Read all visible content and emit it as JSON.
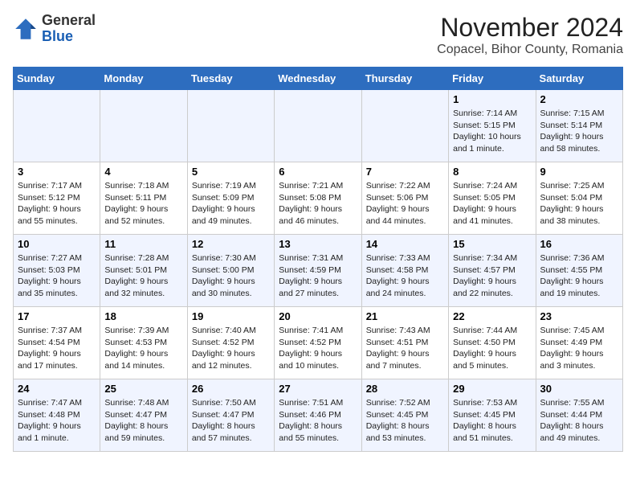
{
  "header": {
    "logo_line1": "General",
    "logo_line2": "Blue",
    "title": "November 2024",
    "subtitle": "Copacel, Bihor County, Romania"
  },
  "weekdays": [
    "Sunday",
    "Monday",
    "Tuesday",
    "Wednesday",
    "Thursday",
    "Friday",
    "Saturday"
  ],
  "weeks": [
    [
      {
        "day": "",
        "info": ""
      },
      {
        "day": "",
        "info": ""
      },
      {
        "day": "",
        "info": ""
      },
      {
        "day": "",
        "info": ""
      },
      {
        "day": "",
        "info": ""
      },
      {
        "day": "1",
        "info": "Sunrise: 7:14 AM\nSunset: 5:15 PM\nDaylight: 10 hours and 1 minute."
      },
      {
        "day": "2",
        "info": "Sunrise: 7:15 AM\nSunset: 5:14 PM\nDaylight: 9 hours and 58 minutes."
      }
    ],
    [
      {
        "day": "3",
        "info": "Sunrise: 7:17 AM\nSunset: 5:12 PM\nDaylight: 9 hours and 55 minutes."
      },
      {
        "day": "4",
        "info": "Sunrise: 7:18 AM\nSunset: 5:11 PM\nDaylight: 9 hours and 52 minutes."
      },
      {
        "day": "5",
        "info": "Sunrise: 7:19 AM\nSunset: 5:09 PM\nDaylight: 9 hours and 49 minutes."
      },
      {
        "day": "6",
        "info": "Sunrise: 7:21 AM\nSunset: 5:08 PM\nDaylight: 9 hours and 46 minutes."
      },
      {
        "day": "7",
        "info": "Sunrise: 7:22 AM\nSunset: 5:06 PM\nDaylight: 9 hours and 44 minutes."
      },
      {
        "day": "8",
        "info": "Sunrise: 7:24 AM\nSunset: 5:05 PM\nDaylight: 9 hours and 41 minutes."
      },
      {
        "day": "9",
        "info": "Sunrise: 7:25 AM\nSunset: 5:04 PM\nDaylight: 9 hours and 38 minutes."
      }
    ],
    [
      {
        "day": "10",
        "info": "Sunrise: 7:27 AM\nSunset: 5:03 PM\nDaylight: 9 hours and 35 minutes."
      },
      {
        "day": "11",
        "info": "Sunrise: 7:28 AM\nSunset: 5:01 PM\nDaylight: 9 hours and 32 minutes."
      },
      {
        "day": "12",
        "info": "Sunrise: 7:30 AM\nSunset: 5:00 PM\nDaylight: 9 hours and 30 minutes."
      },
      {
        "day": "13",
        "info": "Sunrise: 7:31 AM\nSunset: 4:59 PM\nDaylight: 9 hours and 27 minutes."
      },
      {
        "day": "14",
        "info": "Sunrise: 7:33 AM\nSunset: 4:58 PM\nDaylight: 9 hours and 24 minutes."
      },
      {
        "day": "15",
        "info": "Sunrise: 7:34 AM\nSunset: 4:57 PM\nDaylight: 9 hours and 22 minutes."
      },
      {
        "day": "16",
        "info": "Sunrise: 7:36 AM\nSunset: 4:55 PM\nDaylight: 9 hours and 19 minutes."
      }
    ],
    [
      {
        "day": "17",
        "info": "Sunrise: 7:37 AM\nSunset: 4:54 PM\nDaylight: 9 hours and 17 minutes."
      },
      {
        "day": "18",
        "info": "Sunrise: 7:39 AM\nSunset: 4:53 PM\nDaylight: 9 hours and 14 minutes."
      },
      {
        "day": "19",
        "info": "Sunrise: 7:40 AM\nSunset: 4:52 PM\nDaylight: 9 hours and 12 minutes."
      },
      {
        "day": "20",
        "info": "Sunrise: 7:41 AM\nSunset: 4:52 PM\nDaylight: 9 hours and 10 minutes."
      },
      {
        "day": "21",
        "info": "Sunrise: 7:43 AM\nSunset: 4:51 PM\nDaylight: 9 hours and 7 minutes."
      },
      {
        "day": "22",
        "info": "Sunrise: 7:44 AM\nSunset: 4:50 PM\nDaylight: 9 hours and 5 minutes."
      },
      {
        "day": "23",
        "info": "Sunrise: 7:45 AM\nSunset: 4:49 PM\nDaylight: 9 hours and 3 minutes."
      }
    ],
    [
      {
        "day": "24",
        "info": "Sunrise: 7:47 AM\nSunset: 4:48 PM\nDaylight: 9 hours and 1 minute."
      },
      {
        "day": "25",
        "info": "Sunrise: 7:48 AM\nSunset: 4:47 PM\nDaylight: 8 hours and 59 minutes."
      },
      {
        "day": "26",
        "info": "Sunrise: 7:50 AM\nSunset: 4:47 PM\nDaylight: 8 hours and 57 minutes."
      },
      {
        "day": "27",
        "info": "Sunrise: 7:51 AM\nSunset: 4:46 PM\nDaylight: 8 hours and 55 minutes."
      },
      {
        "day": "28",
        "info": "Sunrise: 7:52 AM\nSunset: 4:45 PM\nDaylight: 8 hours and 53 minutes."
      },
      {
        "day": "29",
        "info": "Sunrise: 7:53 AM\nSunset: 4:45 PM\nDaylight: 8 hours and 51 minutes."
      },
      {
        "day": "30",
        "info": "Sunrise: 7:55 AM\nSunset: 4:44 PM\nDaylight: 8 hours and 49 minutes."
      }
    ]
  ]
}
